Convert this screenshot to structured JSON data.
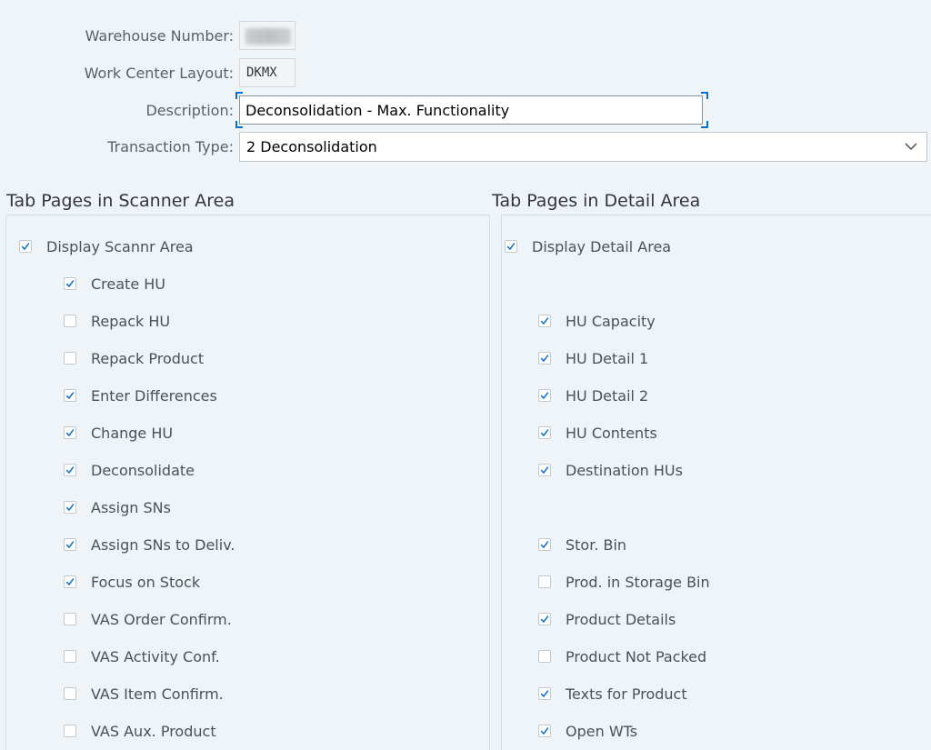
{
  "header": {
    "warehouse_number_label": "Warehouse Number:",
    "work_center_layout_label": "Work Center Layout:",
    "work_center_layout_value": "DKMX",
    "description_label": "Description:",
    "description_value": "Deconsolidation - Max. Functionality",
    "transaction_type_label": "Transaction Type:",
    "transaction_type_value": "2 Deconsolidation"
  },
  "scanner": {
    "title": "Tab Pages in Scanner Area",
    "display": {
      "label": "Display Scannr Area",
      "checked": true
    },
    "items": [
      {
        "label": "Create HU",
        "checked": true
      },
      {
        "label": "Repack HU",
        "checked": false
      },
      {
        "label": "Repack Product",
        "checked": false
      },
      {
        "label": "Enter Differences",
        "checked": true
      },
      {
        "label": "Change HU",
        "checked": true
      },
      {
        "label": "Deconsolidate",
        "checked": true
      },
      {
        "label": "Assign SNs",
        "checked": true
      },
      {
        "label": "Assign SNs to Deliv.",
        "checked": true
      },
      {
        "label": "Focus on Stock",
        "checked": true
      },
      {
        "label": "VAS Order Confirm.",
        "checked": false
      },
      {
        "label": "VAS Activity Conf.",
        "checked": false
      },
      {
        "label": "VAS Item Confirm.",
        "checked": false
      },
      {
        "label": "VAS Aux. Product",
        "checked": false
      }
    ]
  },
  "detail": {
    "title": "Tab Pages in Detail Area",
    "display": {
      "label": "Display Detail Area",
      "checked": true
    },
    "items": [
      {
        "label": "HU Capacity",
        "checked": true
      },
      {
        "label": "HU Detail 1",
        "checked": true
      },
      {
        "label": "HU Detail 2",
        "checked": true
      },
      {
        "label": "HU Contents",
        "checked": true
      },
      {
        "label": "Destination HUs",
        "checked": true
      },
      {
        "label": "Stor. Bin",
        "checked": true
      },
      {
        "label": "Prod. in Storage Bin",
        "checked": false
      },
      {
        "label": "Product Details",
        "checked": true
      },
      {
        "label": "Product Not Packed",
        "checked": false
      },
      {
        "label": "Texts for Product",
        "checked": true
      },
      {
        "label": "Open WTs",
        "checked": true
      }
    ]
  },
  "colors": {
    "background": "#eff4f9",
    "checkmark": "#0a6ed1",
    "focus": "#0a6ed1"
  }
}
